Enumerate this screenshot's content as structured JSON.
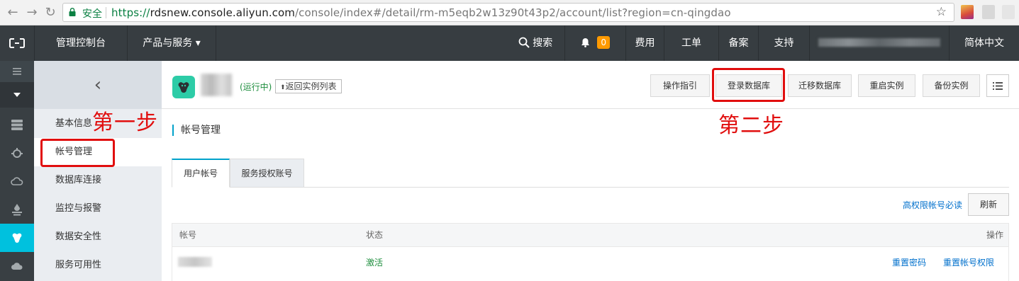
{
  "browser": {
    "secure_label": "安全",
    "url_scheme": "https://",
    "url_host": "rdsnew.console.aliyun.com",
    "url_path": "/console/index#/detail/rm-m5eqb2w13z90t43p2/account/list?region=cn-qingdao",
    "back_icon": "←",
    "forward_icon": "→",
    "reload_icon": "↻",
    "star_icon": "☆"
  },
  "topnav": {
    "console": "管理控制台",
    "products": "产品与服务",
    "products_caret": "▾",
    "search": "搜索",
    "notification_count": "0",
    "billing": "费用",
    "tickets": "工单",
    "record": "备案",
    "support": "支持",
    "language": "简体中文"
  },
  "sidebar": {
    "back_symbol": "‹",
    "items": [
      {
        "label": "基本信息"
      },
      {
        "label": "帐号管理"
      },
      {
        "label": "数据库连接"
      },
      {
        "label": "监控与报警"
      },
      {
        "label": "数据安全性"
      },
      {
        "label": "服务可用性"
      }
    ]
  },
  "instance": {
    "status": "(运行中)",
    "back_to_list": "返回实例列表",
    "back_arrow": "⬆"
  },
  "actions": {
    "guide": "操作指引",
    "login_db": "登录数据库",
    "migrate_db": "迁移数据库",
    "restart": "重启实例",
    "backup": "备份实例"
  },
  "section": {
    "title": "帐号管理"
  },
  "tabs": [
    {
      "label": "用户帐号"
    },
    {
      "label": "服务授权账号"
    }
  ],
  "toolbar": {
    "admin_notice": "高权限帐号必读",
    "refresh": "刷新"
  },
  "table": {
    "headers": {
      "account": "帐号",
      "status": "状态",
      "actions": "操作"
    },
    "rows": [
      {
        "status": "激活",
        "reset_password": "重置密码",
        "reset_permissions": "重置帐号权限"
      }
    ]
  },
  "annotations": {
    "step1": "第一步",
    "step2": "第二步"
  },
  "colors": {
    "topnav_bg": "#373d41",
    "accent": "#00c1de",
    "link": "#0070cc",
    "annotation": "#e10e0e",
    "status_green": "#1e8e3e",
    "badge": "#ff9a00"
  }
}
